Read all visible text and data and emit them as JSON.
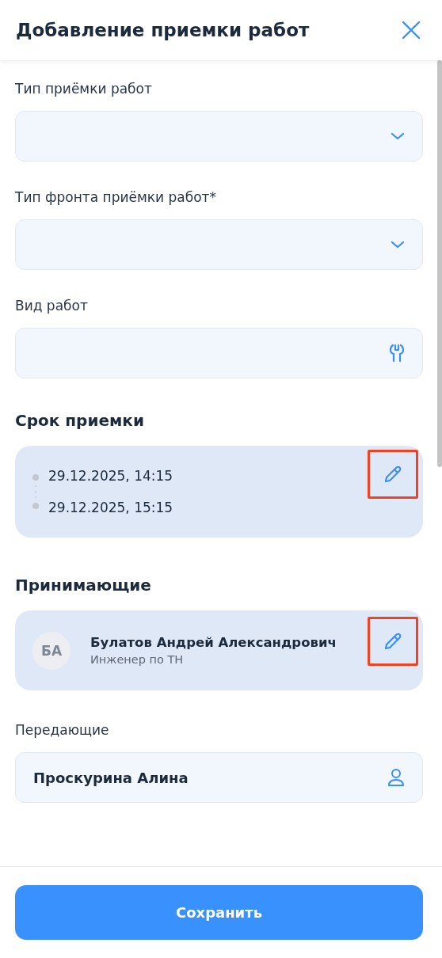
{
  "header": {
    "title": "Добавление приемки работ"
  },
  "fields": [
    {
      "label": "Тип приёмки работ",
      "kind": "select"
    },
    {
      "label": "Тип фронта приёмки работ*",
      "kind": "select"
    },
    {
      "label": "Вид работ",
      "kind": "tool"
    }
  ],
  "deadline": {
    "title": "Срок приемки",
    "start": "29.12.2025, 14:15",
    "end": "29.12.2025, 15:15",
    "edit_highlighted": true
  },
  "receivers": {
    "title": "Принимающие",
    "people": [
      {
        "initials": "БА",
        "name": "Булатов Андрей Александрович",
        "role": "Инженер по ТН",
        "edit_highlighted": true
      }
    ]
  },
  "senders": {
    "label": "Передающие",
    "value": "Проскурина Алина"
  },
  "save_button": "Сохранить"
}
